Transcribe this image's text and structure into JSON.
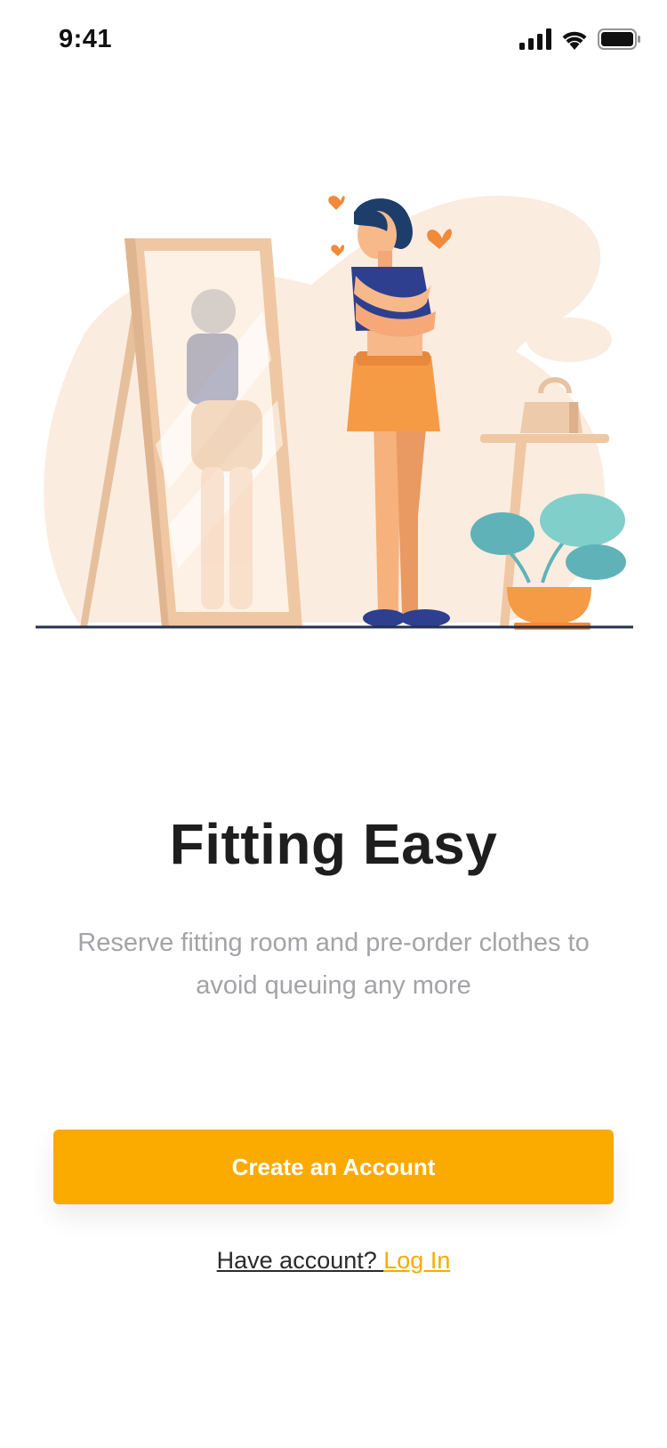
{
  "status_bar": {
    "time": "9:41"
  },
  "icons": {
    "signal": "cellular-signal-icon",
    "wifi": "wifi-icon",
    "battery": "battery-icon"
  },
  "onboarding": {
    "title": "Fitting Easy",
    "subtitle": "Reserve fitting room and pre-order clothes to avoid queuing any more",
    "primary_button_label": "Create an Account",
    "login_prompt": "Have account? ",
    "login_link_label": "Log In"
  },
  "colors": {
    "accent": "#FBAA00",
    "title": "#1E1E1E",
    "subtitle": "#A3A3A8",
    "illustration_background": "#FBEDE0",
    "shirt": "#2E3F8F",
    "shorts": "#F59A45",
    "plant": "#5FB3B8"
  }
}
